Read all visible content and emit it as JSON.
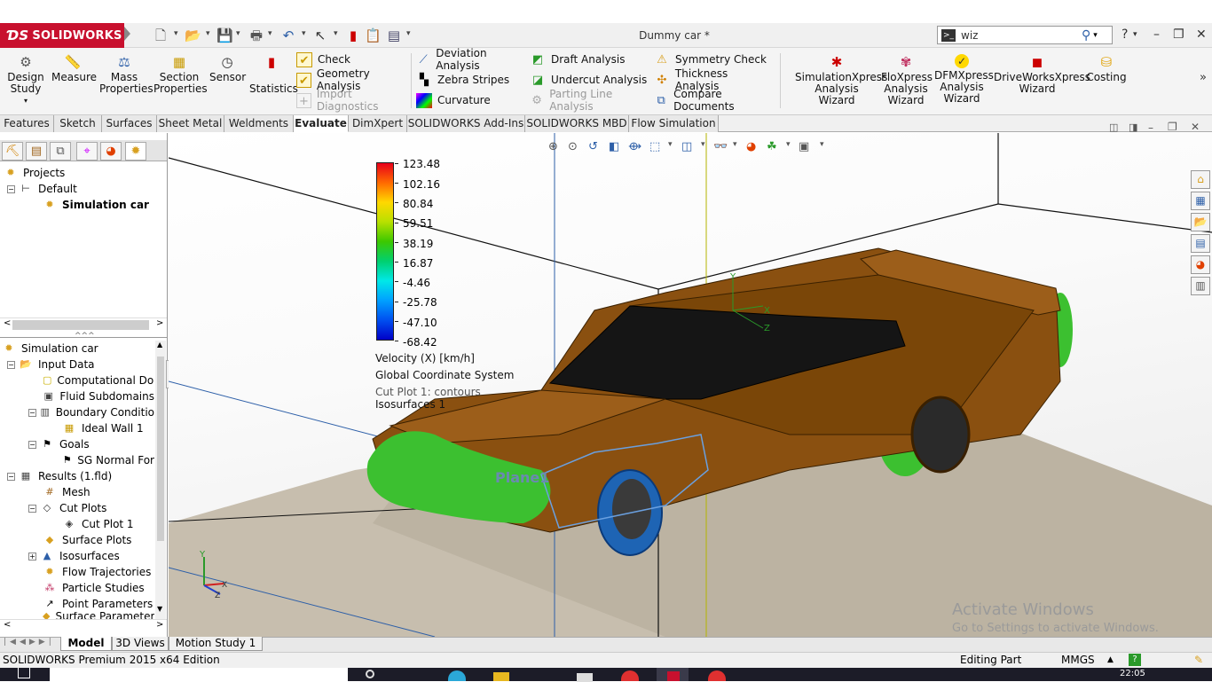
{
  "app": {
    "brand": "SOLIDWORKS",
    "doc_title": "Dummy car *",
    "search_value": "wiz",
    "help_label": "?"
  },
  "ribbon": {
    "big_left": [
      {
        "label": "Design\nStudy",
        "icon": "design-study-icon"
      },
      {
        "label": "Measure",
        "icon": "measure-icon"
      },
      {
        "label": "Mass\nProperties",
        "icon": "mass-properties-icon"
      },
      {
        "label": "Section\nProperties",
        "icon": "section-properties-icon"
      },
      {
        "label": "Sensor",
        "icon": "sensor-icon"
      },
      {
        "label": "Statistics",
        "icon": "statistics-icon"
      }
    ],
    "col1": [
      {
        "label": "Check",
        "icon": "check-icon",
        "disabled": false
      },
      {
        "label": "Geometry Analysis",
        "icon": "geometry-analysis-icon",
        "disabled": false
      },
      {
        "label": "Import Diagnostics",
        "icon": "import-diagnostics-icon",
        "disabled": true
      }
    ],
    "col2": [
      {
        "label": "Deviation Analysis",
        "icon": "deviation-analysis-icon"
      },
      {
        "label": "Zebra Stripes",
        "icon": "zebra-stripes-icon"
      },
      {
        "label": "Curvature",
        "icon": "curvature-icon"
      }
    ],
    "col3": [
      {
        "label": "Draft Analysis",
        "icon": "draft-analysis-icon",
        "disabled": false
      },
      {
        "label": "Undercut Analysis",
        "icon": "undercut-analysis-icon",
        "disabled": false
      },
      {
        "label": "Parting Line Analysis",
        "icon": "parting-line-icon",
        "disabled": true
      }
    ],
    "col4": [
      {
        "label": "Symmetry Check",
        "icon": "symmetry-check-icon"
      },
      {
        "label": "Thickness Analysis",
        "icon": "thickness-analysis-icon"
      },
      {
        "label": "Compare Documents",
        "icon": "compare-documents-icon"
      }
    ],
    "big_right": [
      {
        "label": "SimulationXpress\nAnalysis Wizard",
        "icon": "simulationxpress-icon"
      },
      {
        "label": "FloXpress\nAnalysis\nWizard",
        "icon": "floxpress-icon"
      },
      {
        "label": "DFMXpress\nAnalysis\nWizard",
        "icon": "dfmxpress-icon"
      },
      {
        "label": "DriveWorksXpress\nWizard",
        "icon": "driveworksxpress-icon"
      },
      {
        "label": "Costing",
        "icon": "costing-icon"
      }
    ]
  },
  "tabs": [
    "Features",
    "Sketch",
    "Surfaces",
    "Sheet Metal",
    "Weldments",
    "Evaluate",
    "DimXpert",
    "SOLIDWORKS Add-Ins",
    "SOLIDWORKS MBD",
    "Flow Simulation"
  ],
  "active_tab": "Evaluate",
  "config_tree": [
    {
      "label": "Projects",
      "bold": false
    },
    {
      "label": "Default",
      "bold": false
    },
    {
      "label": "Simulation car",
      "bold": true
    }
  ],
  "analysis_tree": [
    {
      "label": "Simulation car"
    },
    {
      "label": "Input Data"
    },
    {
      "label": "Computational Dor"
    },
    {
      "label": "Fluid Subdomains"
    },
    {
      "label": "Boundary Conditio"
    },
    {
      "label": "Ideal Wall 1"
    },
    {
      "label": "Goals"
    },
    {
      "label": "SG Normal For"
    },
    {
      "label": "Results (1.fld)"
    },
    {
      "label": "Mesh"
    },
    {
      "label": "Cut Plots"
    },
    {
      "label": "Cut Plot 1"
    },
    {
      "label": "Surface Plots"
    },
    {
      "label": "Isosurfaces"
    },
    {
      "label": "Flow Trajectories"
    },
    {
      "label": "Particle Studies"
    },
    {
      "label": "Point Parameters"
    },
    {
      "label": "Surface Parameters"
    }
  ],
  "legend": {
    "values": [
      "123.48",
      "102.16",
      "80.84",
      "59.51",
      "38.19",
      "16.87",
      "-4.46",
      "-25.78",
      "-47.10",
      "-68.42"
    ],
    "colors": [
      "#e8001a",
      "#ff6a00",
      "#ffd800",
      "#b8e000",
      "#3cc800",
      "#00d070",
      "#00e8e8",
      "#00a0ff",
      "#0050f0",
      "#0000c8"
    ],
    "parameter": "Velocity (X) [km/h]",
    "coordinate_system": "Global Coordinate System",
    "cut_plot": "Cut Plot 1: contours",
    "isosurfaces": "Isosurfaces 1"
  },
  "viewport": {
    "plane_label": "Plane1",
    "watermark_title": "Activate Windows",
    "watermark_sub": "Go to Settings to activate Windows."
  },
  "bottom_tabs": [
    "Model",
    "3D Views",
    "Motion Study 1"
  ],
  "status": {
    "edition": "SOLIDWORKS Premium 2015 x64 Edition",
    "mode": "Editing Part",
    "units": "MMGS",
    "clock": "22:05"
  }
}
